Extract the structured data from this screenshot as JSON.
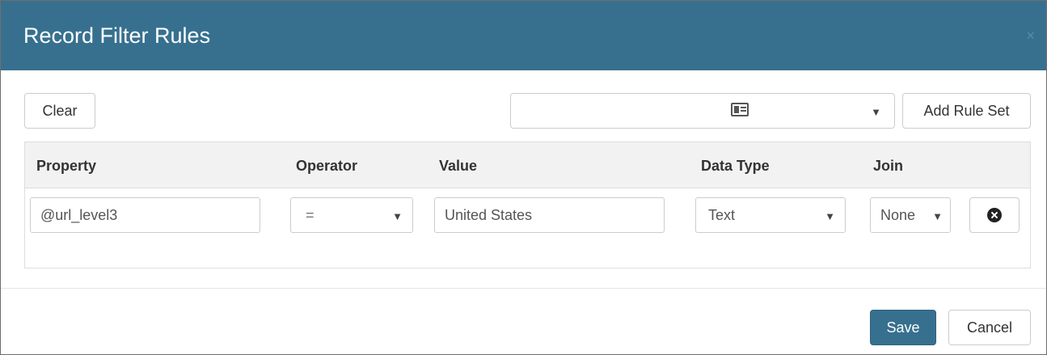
{
  "modal": {
    "title": "Record Filter Rules",
    "close_label": "×"
  },
  "toolbar": {
    "clear_label": "Clear",
    "ruleset_select_value": "",
    "ruleset_select_icon": "id-card-icon",
    "add_ruleset_label": "Add Rule Set"
  },
  "table": {
    "headers": {
      "property": "Property",
      "operator": "Operator",
      "value": "Value",
      "data_type": "Data Type",
      "join": "Join"
    },
    "rows": [
      {
        "property": "@url_level3",
        "operator": "=",
        "value": "United States",
        "data_type": "Text",
        "join": "None",
        "remove_icon": "times-circle-icon"
      }
    ]
  },
  "footer": {
    "save_label": "Save",
    "cancel_label": "Cancel"
  },
  "colors": {
    "header_bg": "#37708f",
    "primary_button": "#37708f"
  }
}
